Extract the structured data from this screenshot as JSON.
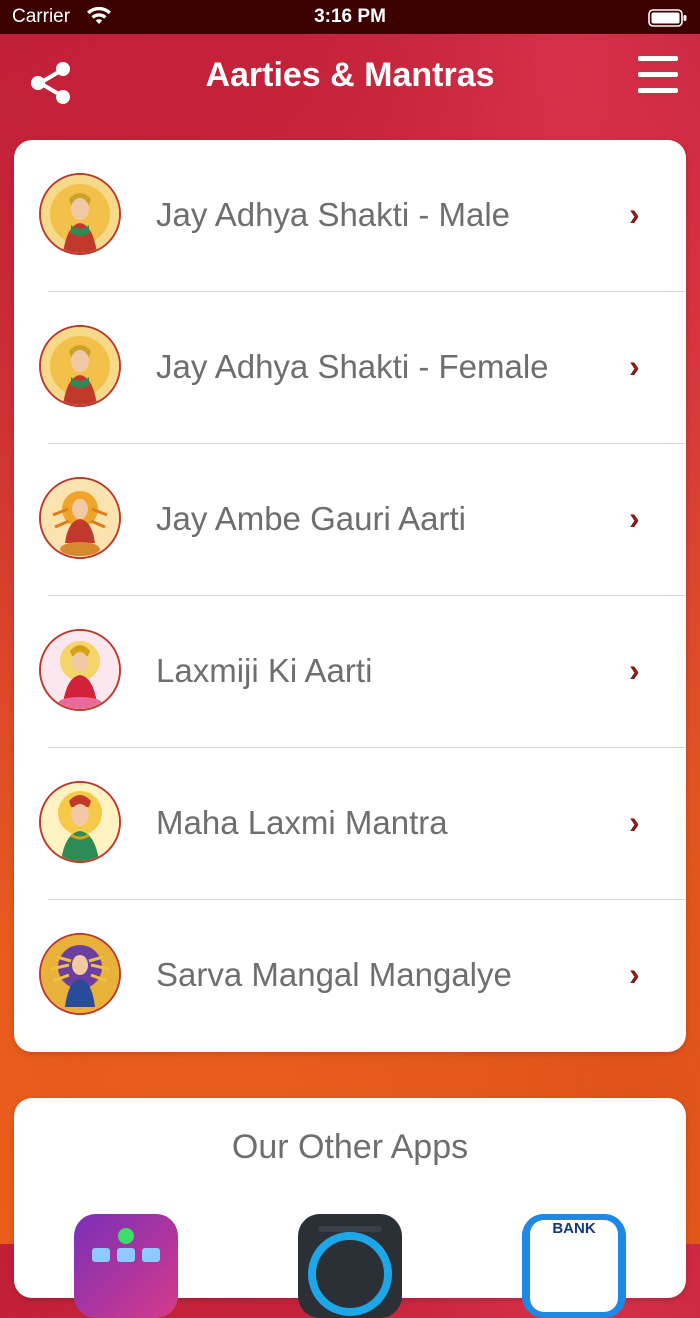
{
  "status": {
    "carrier": "Carrier",
    "time": "3:16 PM"
  },
  "header": {
    "title": "Aarties & Mantras"
  },
  "list": {
    "items": [
      {
        "label": "Jay Adhya Shakti - Male",
        "icon": "goddess-portrait-icon"
      },
      {
        "label": "Jay Adhya Shakti - Female",
        "icon": "goddess-portrait-icon"
      },
      {
        "label": "Jay Ambe Gauri Aarti",
        "icon": "durga-portrait-icon"
      },
      {
        "label": "Laxmiji Ki Aarti",
        "icon": "laxmi-portrait-icon"
      },
      {
        "label": "Maha Laxmi Mantra",
        "icon": "laxmi-portrait-icon"
      },
      {
        "label": "Sarva Mangal Mangalye",
        "icon": "durga-portrait-icon"
      }
    ],
    "chevron": "›"
  },
  "other_apps": {
    "title": "Our Other Apps",
    "apps": [
      {
        "icon": "puzzle-app-icon"
      },
      {
        "icon": "speedometer-app-icon"
      },
      {
        "icon": "bank-balance-app-icon",
        "badge_text": "BANK"
      }
    ]
  },
  "colors": {
    "accent": "#8b1a1a",
    "header_bg": "#3b0000",
    "text_muted": "#6e6e6e"
  }
}
